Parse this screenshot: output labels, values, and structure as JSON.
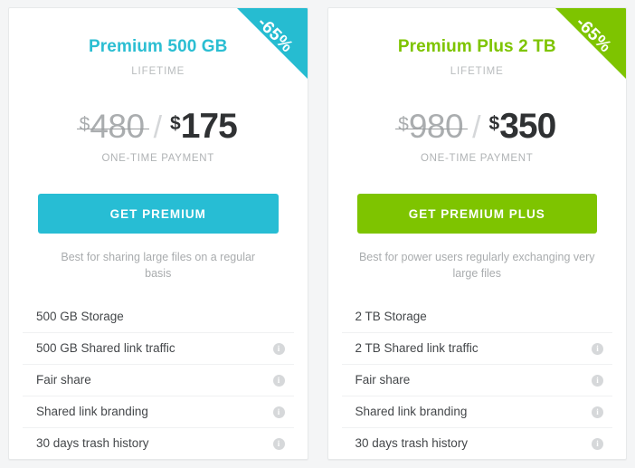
{
  "page": {
    "background_color": "#f4f5f6"
  },
  "plans": [
    {
      "id": "premium-500gb",
      "accent_color": "#27bdd4",
      "ribbon": "-65%",
      "title": "Premium 500 GB",
      "period": "LIFETIME",
      "price_old_currency": "$",
      "price_old": "480",
      "price_separator": "/",
      "price_new_currency": "$",
      "price_new": "175",
      "price_note": "ONE-TIME PAYMENT",
      "cta_label": "GET PREMIUM",
      "blurb": "Best for sharing large files on a regular basis",
      "features": [
        {
          "label": "500 GB Storage",
          "info": false
        },
        {
          "label": "500 GB Shared link traffic",
          "info": true
        },
        {
          "label": "Fair share",
          "info": true
        },
        {
          "label": "Shared link branding",
          "info": true
        },
        {
          "label": "30 days trash history",
          "info": true
        }
      ]
    },
    {
      "id": "premium-plus-2tb",
      "accent_color": "#7ec400",
      "ribbon": "-65%",
      "title": "Premium Plus 2 TB",
      "period": "LIFETIME",
      "price_old_currency": "$",
      "price_old": "980",
      "price_separator": "/",
      "price_new_currency": "$",
      "price_new": "350",
      "price_note": "ONE-TIME PAYMENT",
      "cta_label": "GET PREMIUM PLUS",
      "blurb": "Best for power users regularly exchanging very large files",
      "features": [
        {
          "label": "2 TB Storage",
          "info": false
        },
        {
          "label": "2 TB Shared link traffic",
          "info": true
        },
        {
          "label": "Fair share",
          "info": true
        },
        {
          "label": "Shared link branding",
          "info": true
        },
        {
          "label": "30 days trash history",
          "info": true
        }
      ]
    }
  ],
  "icons": {
    "info": "i"
  }
}
